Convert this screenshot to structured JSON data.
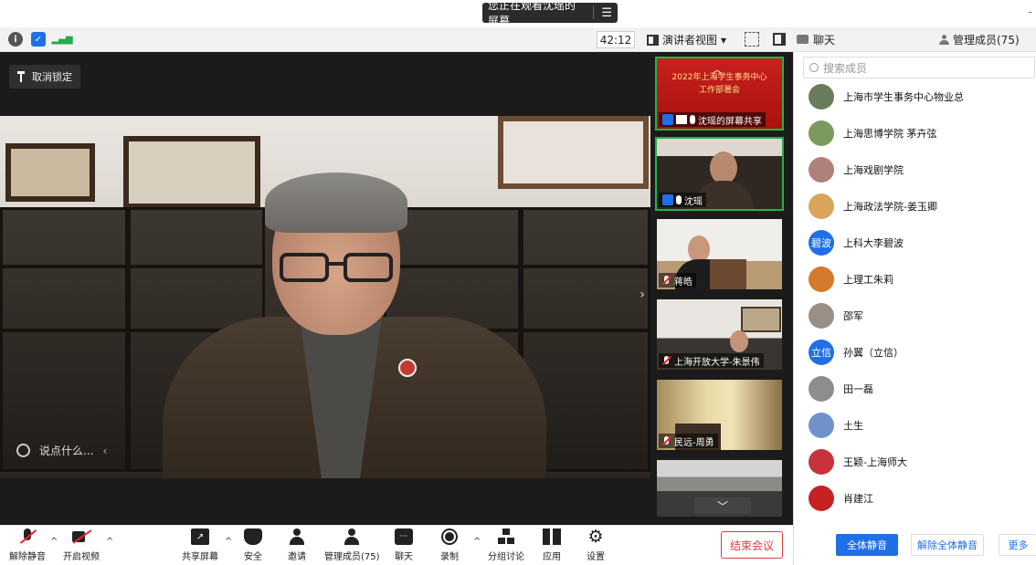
{
  "banner": {
    "text": "您正在观看沈瑶的屏幕",
    "menu_glyph": "☰"
  },
  "corner_dash": "-",
  "toolbar": {
    "timer": "42:12",
    "view_label": "演讲者视图",
    "view_caret": "▾"
  },
  "right_header": {
    "chat_label": "聊天",
    "members_label": "管理成员(75)"
  },
  "main_video": {
    "unpin_label": "取消锁定",
    "chat_placeholder": "说点什么...",
    "chevron": "‹",
    "expand": "›"
  },
  "thumbs": [
    {
      "name": "沈瑶的屏幕共享",
      "slide_line1": "2022年上海学生事务中心",
      "slide_line2": "工作部署会"
    },
    {
      "name": "沈瑶"
    },
    {
      "name": "蒋皓"
    },
    {
      "name": "上海开放大学-朱景伟"
    },
    {
      "name": "民远-周勇"
    }
  ],
  "strip_arrows": {
    "up": "︿",
    "down": "﹀"
  },
  "members": {
    "search_placeholder": "搜索成员",
    "list": [
      {
        "name": "上海市学生事务中心物业总",
        "avatar_text": "",
        "color": "#6a7d5a"
      },
      {
        "name": "上海思博学院 茅卉弦",
        "avatar_text": "",
        "color": "#7c9a5e"
      },
      {
        "name": "上海戏剧学院",
        "avatar_text": "",
        "color": "#b0817a"
      },
      {
        "name": "上海政法学院-姜玉卿",
        "avatar_text": "",
        "color": "#d9a55c"
      },
      {
        "name": "上科大李碧波",
        "avatar_text": "碧波",
        "color": "#1f6fe6"
      },
      {
        "name": "上理工朱莉",
        "avatar_text": "",
        "color": "#d47a2c"
      },
      {
        "name": "邵军",
        "avatar_text": "",
        "color": "#9a8f86"
      },
      {
        "name": "孙翼（立信）",
        "avatar_text": "立信",
        "color": "#1f6fe6"
      },
      {
        "name": "田一磊",
        "avatar_text": "",
        "color": "#8d8d8d"
      },
      {
        "name": "土生",
        "avatar_text": "",
        "color": "#6f93c9"
      },
      {
        "name": "王颖-上海师大",
        "avatar_text": "",
        "color": "#c8323a"
      },
      {
        "name": "肖建江",
        "avatar_text": "",
        "color": "#c62224"
      }
    ],
    "mute_all": "全体静音",
    "unmute_all": "解除全体静音",
    "more": "更多"
  },
  "controls": {
    "unmute": "解除静音",
    "start_video": "开启视频",
    "share": "共享屏幕",
    "security": "安全",
    "invite": "邀请",
    "manage": "管理成员(75)",
    "chat": "聊天",
    "record": "录制",
    "breakout": "分组讨论",
    "apps": "应用",
    "settings": "设置",
    "end": "结束会议",
    "caret": "^"
  }
}
